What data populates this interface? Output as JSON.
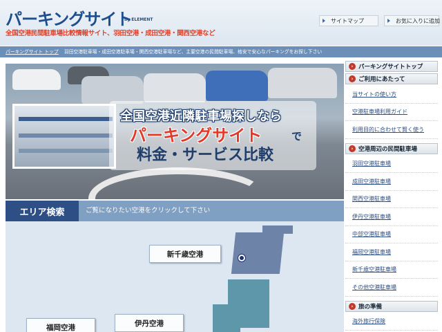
{
  "header": {
    "logo": "パーキングサイト",
    "logo_by": "by ELEMENT",
    "tagline": "全国空港民間駐車場比較情報サイト、羽田空港・成田空港・関西空港など",
    "sitemap_label": "サイトマップ",
    "favorite_label": "お気に入りに追加"
  },
  "breadcrumb": {
    "home": "パーキングサイト トップ",
    "text": "羽田空港駐車場・成田空港駐車場・関西空港駐車場など、主要空港の民間駐車場、格安で安心なパーキングをお探し下さい"
  },
  "hero": {
    "line1": "全国空港近隣駐車場探しなら",
    "line2": "パーキングサイト",
    "line2_suffix": "で",
    "line3": "料金・サービス比較"
  },
  "area": {
    "title": "エリア検索",
    "subtitle": "ご覧になりたい空港をクリックして下さい",
    "airports": [
      "新千歳空港",
      "伊丹空港",
      "福岡空港"
    ]
  },
  "sidebar": {
    "top_link": "パーキングサイトトップ",
    "sections": [
      {
        "heading": "ご利用にあたって",
        "links": [
          "当サイトの使い方",
          "空港駐車場利用ガイド",
          "利用目的に合わせて賢く使う"
        ]
      },
      {
        "heading": "空港周辺の民間駐車場",
        "links": [
          "羽田空港駐車場",
          "成田空港駐車場",
          "関西空港駐車場",
          "伊丹空港駐車場",
          "中部空港駐車場",
          "福岡空港駐車場",
          "新千歳空港駐車場",
          "その他空港駐車場"
        ]
      },
      {
        "heading": "旅の準備",
        "links": [
          "海外旅行保険"
        ]
      }
    ]
  },
  "colors": {
    "brand_blue": "#1f4e8c",
    "accent_red": "#e0412b",
    "bar_blue": "#6b8fb8",
    "area_dark": "#2e4f86"
  }
}
